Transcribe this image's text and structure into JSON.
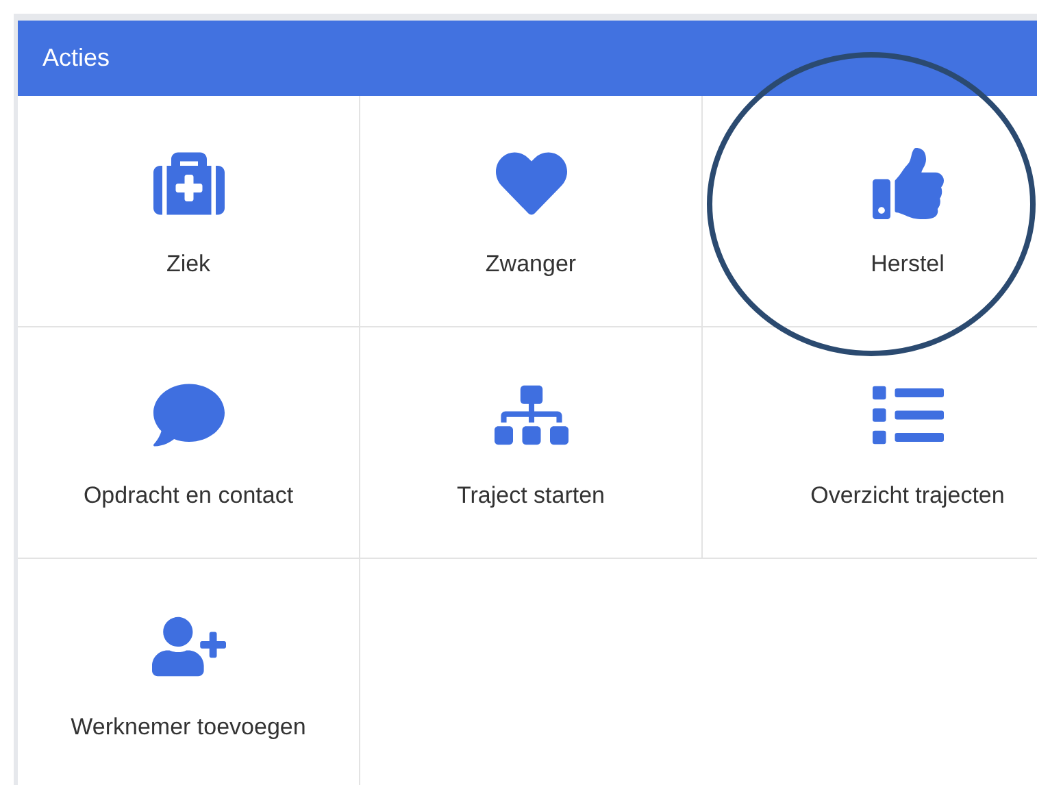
{
  "panel": {
    "title": "Acties"
  },
  "actions": [
    {
      "label": "Ziek",
      "highlighted": false
    },
    {
      "label": "Zwanger",
      "highlighted": false
    },
    {
      "label": "Herstel",
      "highlighted": true
    },
    {
      "label": "Opdracht en contact",
      "highlighted": false
    },
    {
      "label": "Traject starten",
      "highlighted": false
    },
    {
      "label": "Overzicht trajecten",
      "highlighted": false
    },
    {
      "label": "Werknemer toevoegen",
      "highlighted": false
    }
  ]
}
